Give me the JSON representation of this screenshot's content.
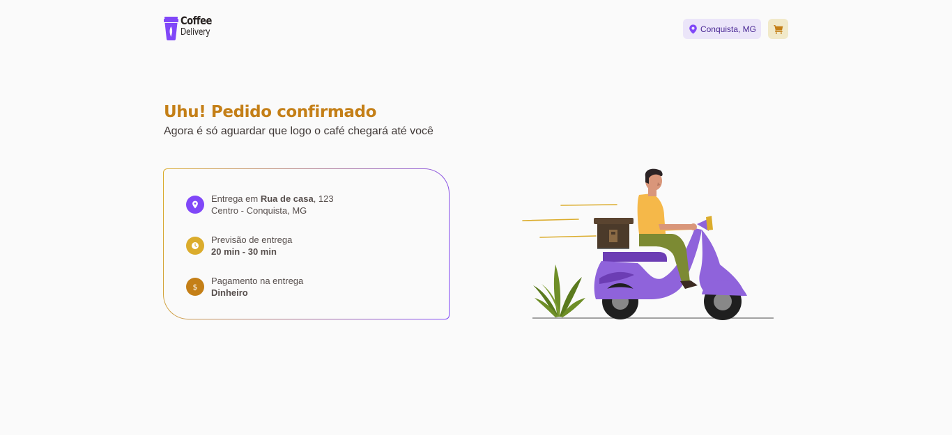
{
  "header": {
    "logo_title": "Coffee",
    "logo_subtitle": "Delivery",
    "location": "Conquista, MG",
    "cart_icon": "shopping-cart-icon"
  },
  "main": {
    "title": "Uhu! Pedido confirmado",
    "subtitle": "Agora é só aguardar que logo o café chegará até você"
  },
  "order_info": {
    "delivery": {
      "icon": "map-pin-icon",
      "prefix": "Entrega em ",
      "street": "Rua de casa",
      "number": ", 123",
      "district": "Centro - Conquista, MG"
    },
    "forecast": {
      "icon": "timer-icon",
      "label": "Previsão de entrega",
      "value": "20 min - 30 min"
    },
    "payment": {
      "icon": "currency-dollar-icon",
      "label": "Pagamento na entrega",
      "value": "Dinheiro"
    }
  },
  "colors": {
    "brand_yellow_dark": "#C47F17",
    "brand_yellow": "#DBAC2C",
    "brand_purple": "#8047F8",
    "purple_light": "#EBE5F9",
    "yellow_light": "#F1E9C9"
  }
}
